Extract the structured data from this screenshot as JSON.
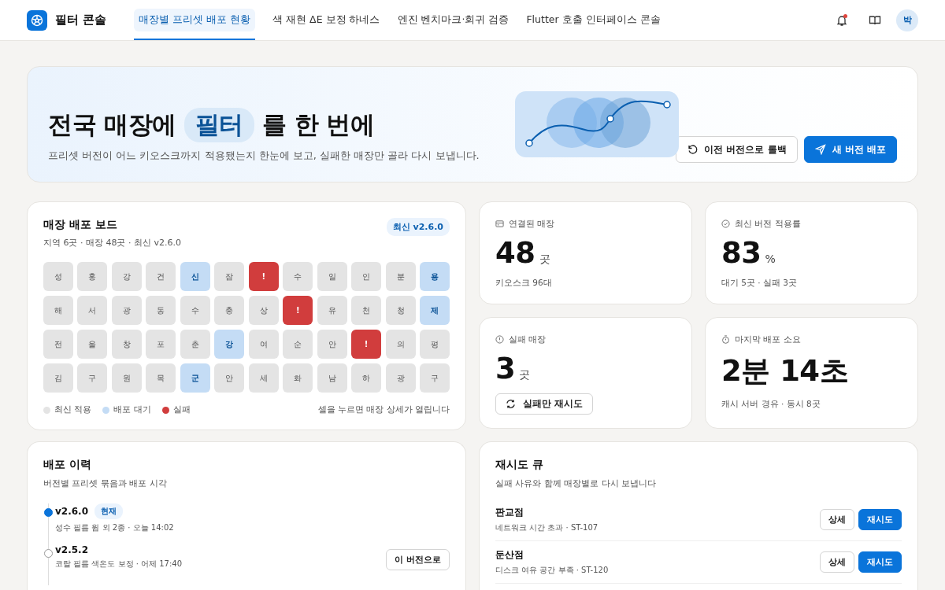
{
  "header": {
    "brand": "필터 콘솔",
    "tabs": [
      {
        "label": "매장별 프리셋 배포 현황",
        "selected": true
      },
      {
        "label": "색 재현 ΔE 보정 하네스",
        "selected": false
      },
      {
        "label": "엔진 벤치마크·회귀 검증",
        "selected": false
      },
      {
        "label": "Flutter 호출 인터페이스 콘솔",
        "selected": false
      }
    ],
    "notification_dot": true,
    "avatar": "박"
  },
  "hero": {
    "title_before": "전국 매장에",
    "title_highlight": "필터",
    "title_after": "를 한 번에",
    "subtitle": "프리셋 버전이 어느 키오스크까지 적용됐는지 한눈에 보고, 실패한 매장만 골라 다시 보냅니다.",
    "buttons": [
      {
        "kind": "secondary",
        "label": "이전 버전으로 롤백"
      },
      {
        "kind": "primary",
        "label": "새 버전 배포"
      }
    ]
  },
  "board": {
    "title": "매장 배포 보드",
    "subtitle": "지역 6곳 · 매장 48곳 · 최신 v2.6.0",
    "badge": "최신 v2.6.0",
    "rows": [
      [
        {
          "label": "성",
          "kind": "done"
        },
        {
          "label": "홍",
          "kind": "done"
        },
        {
          "label": "강",
          "kind": "done"
        },
        {
          "label": "건",
          "kind": "done"
        },
        {
          "label": "신",
          "kind": "pending"
        },
        {
          "label": "잠",
          "kind": "done"
        },
        {
          "label": "!",
          "kind": "failed"
        },
        {
          "label": "수",
          "kind": "done"
        },
        {
          "label": "일",
          "kind": "done"
        },
        {
          "label": "인",
          "kind": "done"
        },
        {
          "label": "분",
          "kind": "done"
        },
        {
          "label": "용",
          "kind": "pending"
        }
      ],
      [
        {
          "label": "해",
          "kind": "done"
        },
        {
          "label": "서",
          "kind": "done"
        },
        {
          "label": "광",
          "kind": "done"
        },
        {
          "label": "동",
          "kind": "done"
        },
        {
          "label": "수",
          "kind": "done"
        },
        {
          "label": "충",
          "kind": "done"
        },
        {
          "label": "상",
          "kind": "done"
        },
        {
          "label": "!",
          "kind": "failed"
        },
        {
          "label": "유",
          "kind": "done"
        },
        {
          "label": "천",
          "kind": "done"
        },
        {
          "label": "청",
          "kind": "done"
        },
        {
          "label": "제",
          "kind": "pending"
        }
      ],
      [
        {
          "label": "전",
          "kind": "done"
        },
        {
          "label": "울",
          "kind": "done"
        },
        {
          "label": "창",
          "kind": "done"
        },
        {
          "label": "포",
          "kind": "done"
        },
        {
          "label": "춘",
          "kind": "done"
        },
        {
          "label": "강",
          "kind": "pending"
        },
        {
          "label": "여",
          "kind": "done"
        },
        {
          "label": "순",
          "kind": "done"
        },
        {
          "label": "안",
          "kind": "done"
        },
        {
          "label": "!",
          "kind": "failed"
        },
        {
          "label": "의",
          "kind": "done"
        },
        {
          "label": "평",
          "kind": "done"
        }
      ],
      [
        {
          "label": "김",
          "kind": "done"
        },
        {
          "label": "구",
          "kind": "done"
        },
        {
          "label": "원",
          "kind": "done"
        },
        {
          "label": "목",
          "kind": "done"
        },
        {
          "label": "군",
          "kind": "pending"
        },
        {
          "label": "안",
          "kind": "done"
        },
        {
          "label": "세",
          "kind": "done"
        },
        {
          "label": "화",
          "kind": "done"
        },
        {
          "label": "남",
          "kind": "done"
        },
        {
          "label": "하",
          "kind": "done"
        },
        {
          "label": "광",
          "kind": "done"
        },
        {
          "label": "구",
          "kind": "done"
        }
      ]
    ],
    "legend": [
      {
        "label": "최신 적용",
        "color": "#e4e4e4"
      },
      {
        "label": "배포 대기",
        "color": "#c4dcf5"
      },
      {
        "label": "실패",
        "color": "#d13d3d"
      }
    ],
    "hint": "셀을 누르면 매장 상세가 열립니다"
  },
  "stats": [
    {
      "label": "연결된 매장",
      "value": "48",
      "unit": "곳",
      "sub": "키오스크 96대"
    },
    {
      "label": "최신 버전 적용률",
      "value": "83",
      "unit": "%",
      "sub": "대기 5곳 · 실패 3곳"
    },
    {
      "label": "실패 매장",
      "value": "3",
      "unit": "곳",
      "button": "실패만 재시도"
    },
    {
      "label": "마지막 배포 소요",
      "value": "2분 14초",
      "sub": "캐시 서버 경유 · 동시 8곳"
    }
  ],
  "history": {
    "title": "배포 이력",
    "subtitle": "버전별 프리셋 묶음과 배포 시각",
    "items": [
      {
        "version": "v2.6.0",
        "current": true,
        "badge": "현재",
        "meta": "성수 필름 윔 외 2종 · 오늘 14:02"
      },
      {
        "version": "v2.5.2",
        "current": false,
        "meta": "코랄 필름 색온도 보정 · 어제 17:40",
        "button": "이 버전으로"
      }
    ]
  },
  "queue": {
    "title": "재시도 큐",
    "subtitle": "실패 사유와 함께 매장별로 다시 보냅니다",
    "items": [
      {
        "name": "판교점",
        "reason": "네트워크 시간 초과 · ST-107",
        "buttons": [
          "상세",
          "재시도"
        ]
      },
      {
        "name": "둔산점",
        "reason": "디스크 여유 공간 부족 · ST-120",
        "buttons": [
          "상세",
          "재시도"
        ]
      }
    ]
  }
}
